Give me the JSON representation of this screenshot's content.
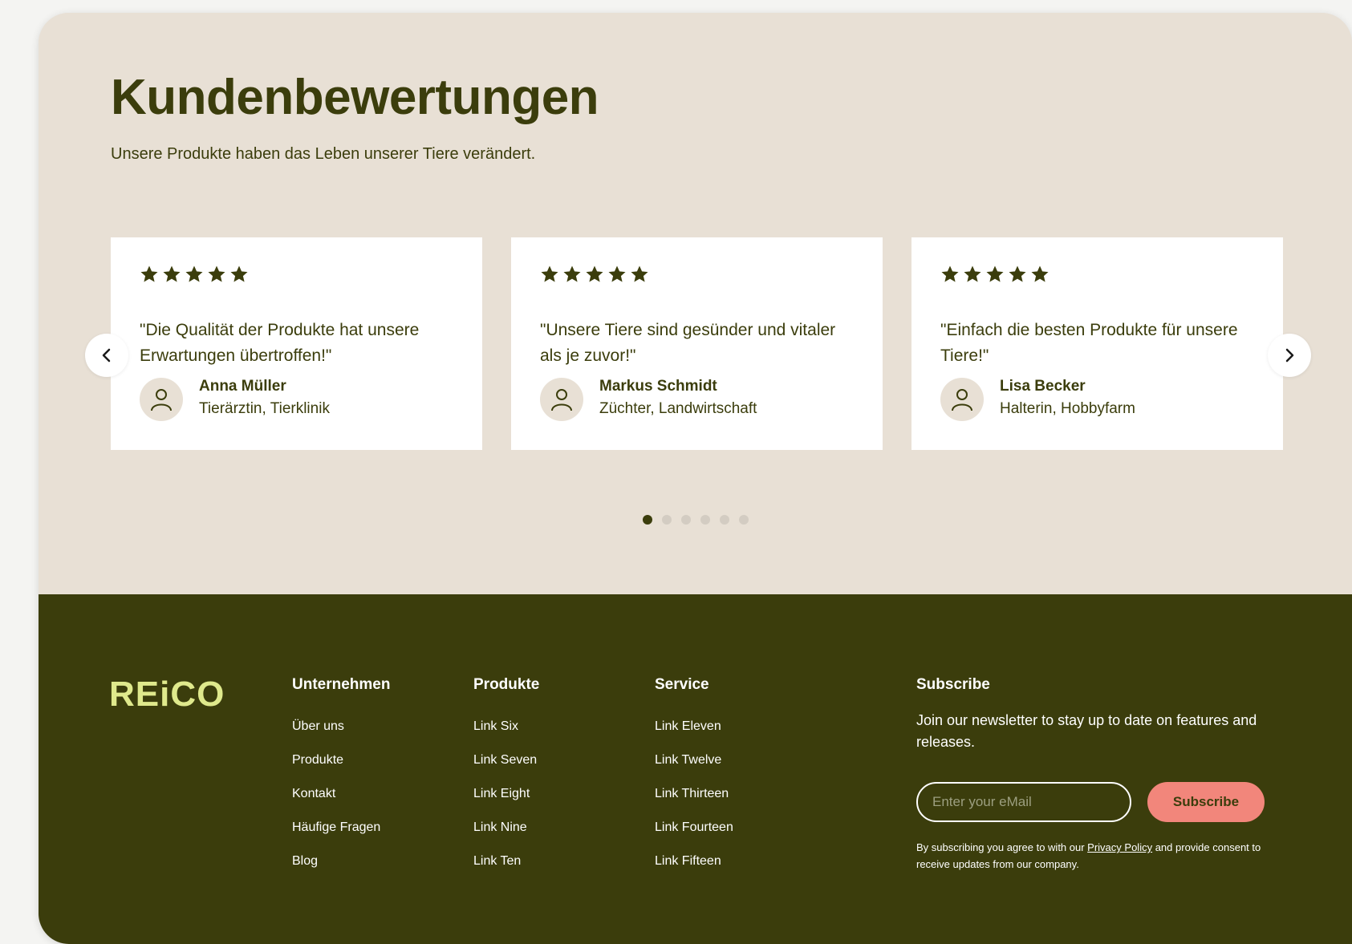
{
  "reviews": {
    "title": "Kundenbewertungen",
    "subtitle": "Unsere Produkte haben das Leben unserer Tiere verändert.",
    "cards": [
      {
        "rating": 5,
        "quote": "\"Die Qualität der Produkte hat unsere Erwartungen übertroffen!\"",
        "name": "Anna Müller",
        "role": "Tierärztin, Tierklinik"
      },
      {
        "rating": 5,
        "quote": "\"Unsere Tiere sind gesünder und vitaler als je zuvor!\"",
        "name": "Markus Schmidt",
        "role": "Züchter, Landwirtschaft"
      },
      {
        "rating": 5,
        "quote": "\"Einfach die besten Produkte für unsere Tiere!\"",
        "name": "Lisa Becker",
        "role": "Halterin, Hobbyfarm"
      }
    ],
    "prev_icon": "chevron-left-icon",
    "next_icon": "chevron-right-icon",
    "pagination": {
      "total": 6,
      "active": 1
    }
  },
  "footer": {
    "logo": "REiCO",
    "columns": [
      {
        "heading": "Unternehmen",
        "links": [
          "Über uns",
          "Produkte",
          "Kontakt",
          "Häufige Fragen",
          "Blog"
        ]
      },
      {
        "heading": "Produkte",
        "links": [
          "Link Six",
          "Link Seven",
          "Link Eight",
          "Link Nine",
          "Link Ten"
        ]
      },
      {
        "heading": "Service",
        "links": [
          "Link Eleven",
          "Link Twelve",
          "Link Thirteen",
          "Link Fourteen",
          "Link Fifteen"
        ]
      }
    ],
    "subscribe": {
      "heading": "Subscribe",
      "description": "Join our newsletter to stay up to date on features and releases.",
      "email_placeholder": "Enter your eMail",
      "email_value": "",
      "button_label": "Subscribe",
      "legal_before": "By subscribing you agree to with our ",
      "legal_link": "Privacy Policy",
      "legal_after": " and provide consent to receive updates from our company."
    }
  },
  "colors": {
    "page_bg": "#e8e0d5",
    "card_bg": "#ffffff",
    "dark_olive": "#3b3d0c",
    "logo_lime": "#dfe98c",
    "accent_salmon": "#f2867b",
    "dot_inactive": "#d3ccc2"
  }
}
